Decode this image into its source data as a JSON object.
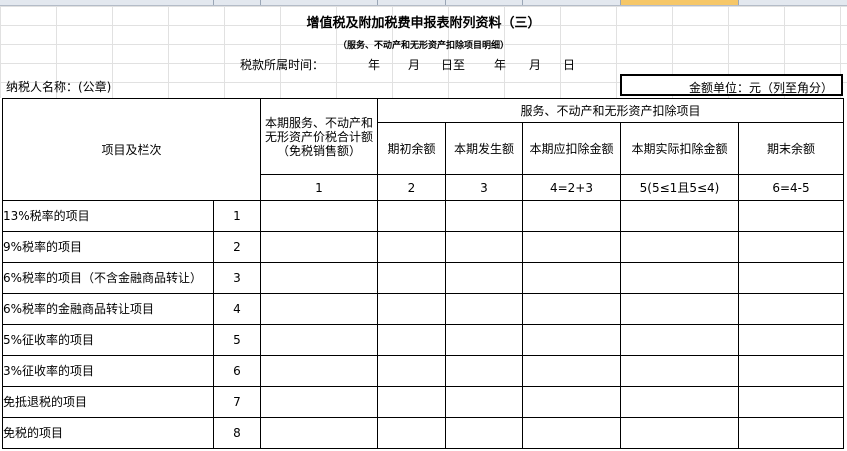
{
  "sheet": {
    "title": "增值税及附加税费申报表附列资料（三）",
    "subtitle": "（服务、不动产和无形资产扣除项目明细）",
    "period": {
      "label": "税款所属时间：",
      "year1": "年",
      "month1": "月",
      "day_to": "日至",
      "year2": "年",
      "month2": "月",
      "day2": "日"
    },
    "taxpayer_label": "纳税人名称：(公章)",
    "unit_label": "金额单位：元（列至角分）"
  },
  "table": {
    "item_header": "项目及栏次",
    "col1_header": "本期服务、不动产和无形资产价税合计额（免税销售额）",
    "group_header": "服务、不动产和无形资产扣除项目",
    "sub_headers": [
      "期初余额",
      "本期发生额",
      "本期应扣除金额",
      "本期实际扣除金额",
      "期末余额"
    ],
    "col_numbers": [
      "1",
      "2",
      "3",
      "4=2+3",
      "5(5≤1且5≤4)",
      "6=4-5"
    ],
    "rows": [
      {
        "label": "13%税率的项目",
        "line": "1"
      },
      {
        "label": "9%税率的项目",
        "line": "2"
      },
      {
        "label": "6%税率的项目（不含金融商品转让）",
        "line": "3"
      },
      {
        "label": "6%税率的金融商品转让项目",
        "line": "4"
      },
      {
        "label": "5%征收率的项目",
        "line": "5"
      },
      {
        "label": "3%征收率的项目",
        "line": "6"
      },
      {
        "label": "免抵退税的项目",
        "line": "7"
      },
      {
        "label": "免税的项目",
        "line": "8"
      }
    ]
  }
}
